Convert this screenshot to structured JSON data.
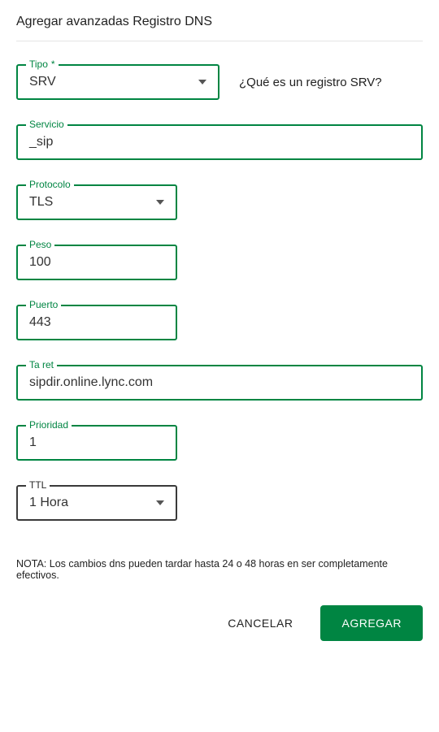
{
  "title": "Agregar avanzadas  Registro DNS",
  "tipo": {
    "label": "Tipo",
    "required": "*",
    "value": "SRV",
    "help": "¿Qué es un registro SRV?"
  },
  "servicio": {
    "label": "Servicio",
    "value": "_sip"
  },
  "protocolo": {
    "label": "Protocolo",
    "value": "TLS"
  },
  "peso": {
    "label": "Peso",
    "value": "100"
  },
  "puerto": {
    "label": "Puerto",
    "value": "443"
  },
  "target": {
    "label": "Ta ret",
    "value": "sipdir.online.lync.com"
  },
  "prioridad": {
    "label": "Prioridad",
    "value": "1"
  },
  "ttl": {
    "label": "TTL",
    "value": "1 Hora"
  },
  "note": "NOTA: Los cambios dns pueden tardar hasta 24 o 48 horas en ser completamente efectivos.",
  "actions": {
    "cancel": "CANCELAR",
    "submit": "AGREGAR"
  }
}
